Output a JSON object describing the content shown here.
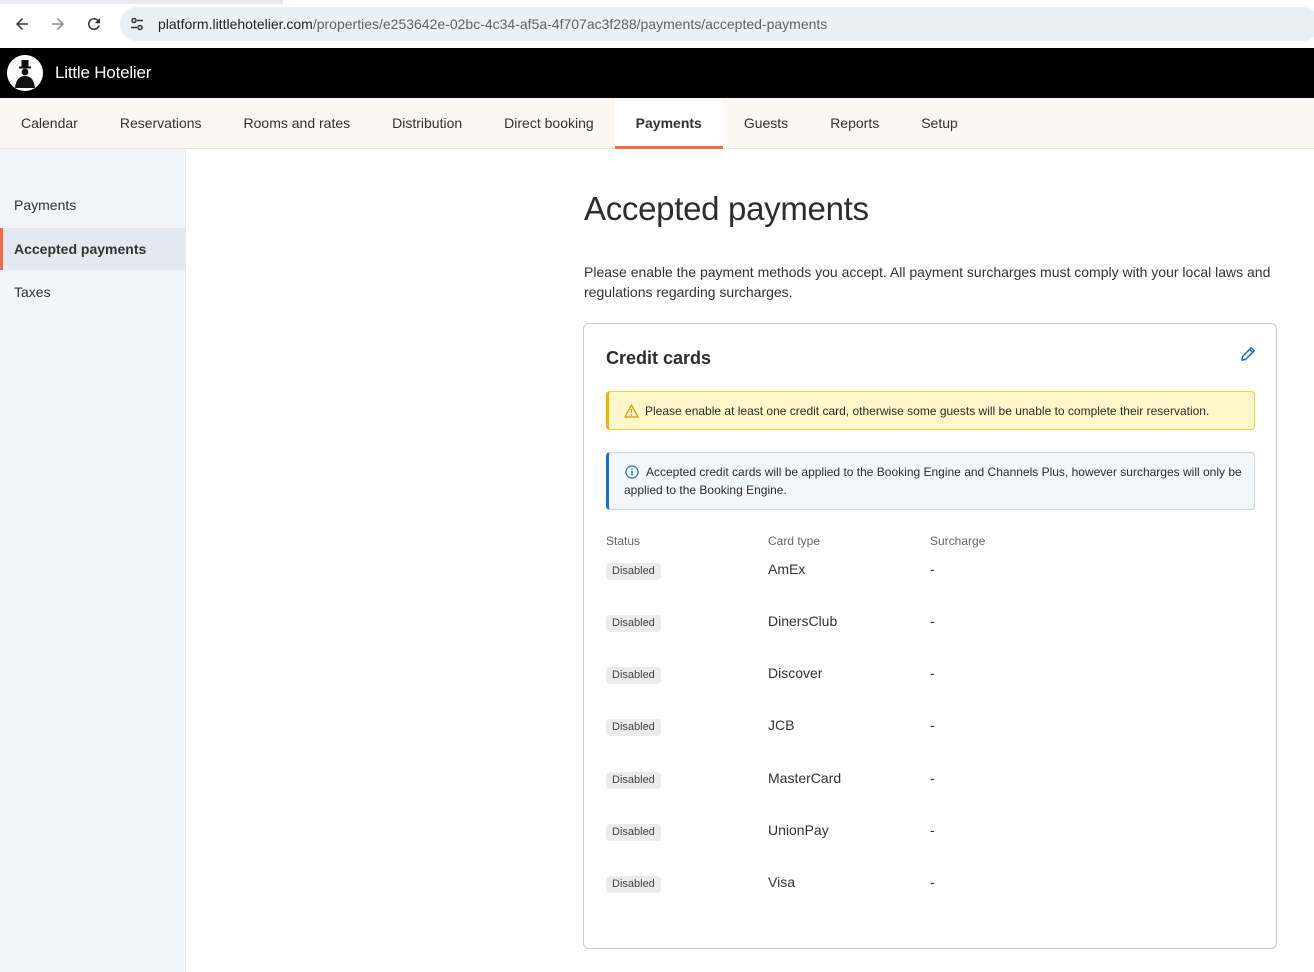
{
  "browser": {
    "url_domain": "platform.littlehotelier.com",
    "url_path": "/properties/e253642e-02bc-4c34-af5a-4f707ac3f288/payments/accepted-payments",
    "icons": [
      "back-arrow-icon",
      "forward-arrow-icon",
      "reload-icon",
      "site-info-icon"
    ]
  },
  "header": {
    "app_name": "Little Hotelier"
  },
  "top_nav": {
    "tabs": [
      {
        "label": "Calendar"
      },
      {
        "label": "Reservations"
      },
      {
        "label": "Rooms and rates"
      },
      {
        "label": "Distribution"
      },
      {
        "label": "Direct booking"
      },
      {
        "label": "Payments",
        "active": true
      },
      {
        "label": "Guests"
      },
      {
        "label": "Reports"
      },
      {
        "label": "Setup"
      }
    ]
  },
  "sidebar": {
    "items": [
      {
        "label": "Payments"
      },
      {
        "label": "Accepted payments",
        "active": true
      },
      {
        "label": "Taxes"
      }
    ]
  },
  "main": {
    "title": "Accepted payments",
    "description": "Please enable the payment methods you accept. All payment surcharges must comply with your local laws and regulations regarding surcharges.",
    "card": {
      "title": "Credit cards",
      "warning": "Please enable at least one credit card, otherwise some guests will be unable to complete their reservation.",
      "info": "Accepted credit cards will be applied to the Booking Engine and Channels Plus, however surcharges will only be applied to the Booking Engine.",
      "columns": {
        "status": "Status",
        "card_type": "Card type",
        "surcharge": "Surcharge"
      },
      "rows": [
        {
          "status": "Disabled",
          "card_type": "AmEx",
          "surcharge": "-"
        },
        {
          "status": "Disabled",
          "card_type": "DinersClub",
          "surcharge": "-"
        },
        {
          "status": "Disabled",
          "card_type": "Discover",
          "surcharge": "-"
        },
        {
          "status": "Disabled",
          "card_type": "JCB",
          "surcharge": "-"
        },
        {
          "status": "Disabled",
          "card_type": "MasterCard",
          "surcharge": "-"
        },
        {
          "status": "Disabled",
          "card_type": "UnionPay",
          "surcharge": "-"
        },
        {
          "status": "Disabled",
          "card_type": "Visa",
          "surcharge": "-"
        }
      ]
    }
  },
  "colors": {
    "accent": "#f26a4b",
    "header_bg": "#000000",
    "nav_bg": "#fbf7f2",
    "sidebar_bg": "#f3f5fa",
    "warning_bg": "#fff6c9",
    "info_border": "#1f6fc5",
    "edit_icon": "#1f6fc5"
  }
}
